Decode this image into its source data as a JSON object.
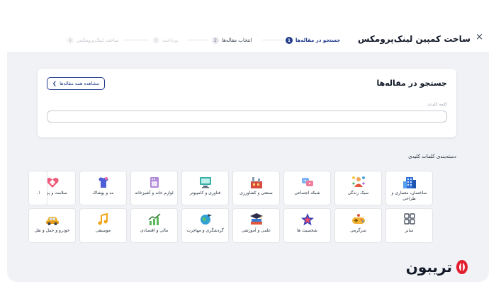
{
  "modal": {
    "title": "ساخت کمپین لینک‌پرومکس",
    "close_glyph": "×"
  },
  "steps": [
    {
      "num": "1",
      "label": "جستجو در مقاله‌ها",
      "state": "active"
    },
    {
      "num": "2",
      "label": "انتخاب مقاله‌ها",
      "state": "upcoming"
    },
    {
      "num": "3",
      "label": "پرداخت",
      "state": "disabled"
    },
    {
      "num": "4",
      "label": "ساخت لینک‌پرومکس",
      "state": "disabled"
    }
  ],
  "search": {
    "title": "جستجو در مقاله‌ها",
    "view_all_label": "مشاهده همه مقاله‌ها",
    "keyword_label": "کلمه کلیدی",
    "keyword_value": "",
    "keyword_placeholder": ""
  },
  "categories": {
    "heading": "دسته‌بندی کلمات کلیدی",
    "row1": [
      {
        "label": "ساختمان، معماری و طراحی",
        "icon": "building-icon"
      },
      {
        "label": "سبک زندگی",
        "icon": "lifestyle-icon"
      },
      {
        "label": "شبکه اجتماعی",
        "icon": "social-network-icon"
      },
      {
        "label": "صنعتی و کشاورزی",
        "icon": "factory-icon"
      },
      {
        "label": "فناوری و کامپیوتر",
        "icon": "computer-icon"
      },
      {
        "label": "لوازم خانه و آشپزخانه",
        "icon": "appliance-icon"
      },
      {
        "label": "مد و پوشاک",
        "icon": "clothing-icon"
      },
      {
        "label": "سلامت و پزشکی",
        "icon": "health-icon"
      },
      {
        "label": "ا",
        "icon": ""
      }
    ],
    "row2": [
      {
        "label": "سایر",
        "icon": "grid-icon"
      },
      {
        "label": "سرگرمی",
        "icon": "gamepad-icon"
      },
      {
        "label": "شخصیت ها",
        "icon": "star-icon"
      },
      {
        "label": "علمی و آموزشی",
        "icon": "books-icon"
      },
      {
        "label": "گردشگری و مهاجرت",
        "icon": "globe-plane-icon"
      },
      {
        "label": "مالی و اقتصادی",
        "icon": "finance-chart-icon"
      },
      {
        "label": "موسیقی",
        "icon": "music-icon"
      },
      {
        "label": "خودرو و حمل و نقل",
        "icon": "car-icon"
      }
    ]
  },
  "brand": {
    "name": "تریبون",
    "color": "#e11d2e"
  },
  "colors": {
    "accent": "#1e3a8a",
    "background": "#f1f2f6"
  }
}
